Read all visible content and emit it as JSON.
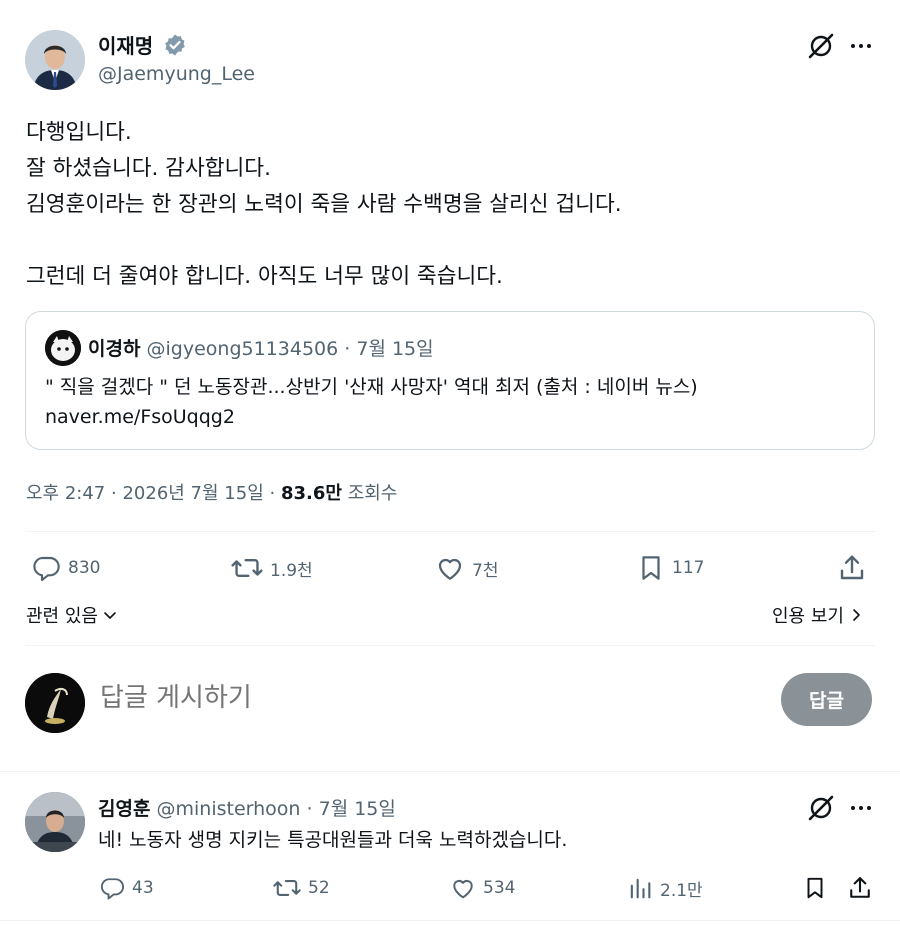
{
  "tweet": {
    "author_name": "이재명",
    "author_handle": "@Jaemyung_Lee",
    "text": "다행입니다.\n잘 하셨습니다. 감사합니다.\n김영훈이라는 한 장관의 노력이 죽을 사람 수백명을 살리신 겁니다.\n\n그런데 더 줄여야 합니다. 아직도 너무 많이 죽습니다.",
    "time": "오후 2:47",
    "date": "2026년 7월 15일",
    "views_count": "83.6만",
    "views_label": "조회수"
  },
  "quote": {
    "name": "이경하",
    "handle": "@igyeong51134506",
    "date": "7월 15일",
    "text": "\" 직을 걸겠다 \" 던 노동장관...상반기 '산재 사망자' 역대 최저 (출처 : 네이버 뉴스)",
    "link": "naver.me/FsoUqqg2"
  },
  "actions": {
    "replies": "830",
    "retweets": "1.9천",
    "likes": "7천",
    "bookmarks": "117"
  },
  "related": {
    "related_label": "관련 있음",
    "quotes_label": "인용 보기"
  },
  "composer": {
    "placeholder": "답글 게시하기",
    "submit_label": "답글"
  },
  "reply": {
    "name": "김영훈",
    "handle": "@ministerhoon",
    "date": "7월 15일",
    "text": "네! 노동자 생명 지키는 특공대원들과 더욱 노력하겠습니다.",
    "replies": "43",
    "retweets": "52",
    "likes": "534",
    "views": "2.1만"
  },
  "colors": {
    "text": "#0f1419",
    "muted": "#536471",
    "border": "#cfd9de",
    "verified": "#829aab",
    "button_disabled": "#8b9297"
  }
}
